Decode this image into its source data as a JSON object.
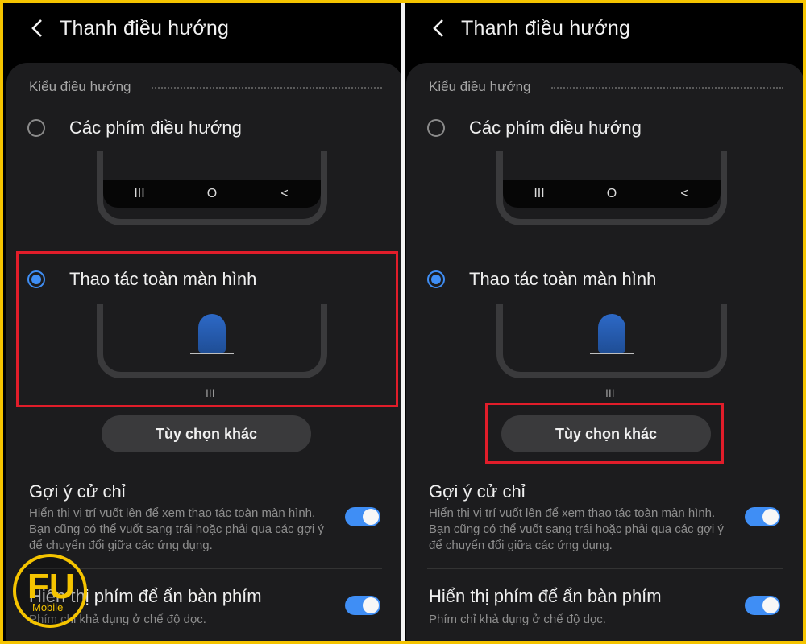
{
  "screens": [
    {
      "title": "Thanh điều hướng",
      "section_label": "Kiểu điều hướng",
      "option1_label": "Các phím điều hướng",
      "option2_label": "Thao tác toàn màn hình",
      "more_options_label": "Tùy chọn khác",
      "handle": "III",
      "navbar": {
        "recent": "III",
        "home": "O",
        "back": "<"
      },
      "gesture_hint_title": "Gợi ý cử chỉ",
      "gesture_hint_desc": "Hiển thị vị trí vuốt lên để xem thao tác toàn màn hình. Bạn cũng có thể vuốt sang trái hoặc phải qua các gợi ý để chuyển đổi giữa các ứng dụng.",
      "show_button_title": "Hiển thị phím để ẩn bàn phím",
      "show_button_desc": "Phím chỉ khả dụng ở chế độ dọc."
    },
    {
      "title": "Thanh điều hướng",
      "section_label": "Kiểu điều hướng",
      "option1_label": "Các phím điều hướng",
      "option2_label": "Thao tác toàn màn hình",
      "more_options_label": "Tùy chọn khác",
      "handle": "III",
      "navbar": {
        "recent": "III",
        "home": "O",
        "back": "<"
      },
      "gesture_hint_title": "Gợi ý cử chỉ",
      "gesture_hint_desc": "Hiển thị vị trí vuốt lên để xem thao tác toàn màn hình. Bạn cũng có thể vuốt sang trái hoặc phải qua các gợi ý để chuyển đổi giữa các ứng dụng.",
      "show_button_title": "Hiển thị phím để ẩn bàn phím",
      "show_button_desc": "Phím chỉ khả dụng ở chế độ dọc."
    }
  ],
  "logo": {
    "main": "FU",
    "sub": "Mobile"
  },
  "colors": {
    "accent": "#3f8ef5",
    "highlight": "#e11d2a",
    "frame": "#f5c400"
  }
}
